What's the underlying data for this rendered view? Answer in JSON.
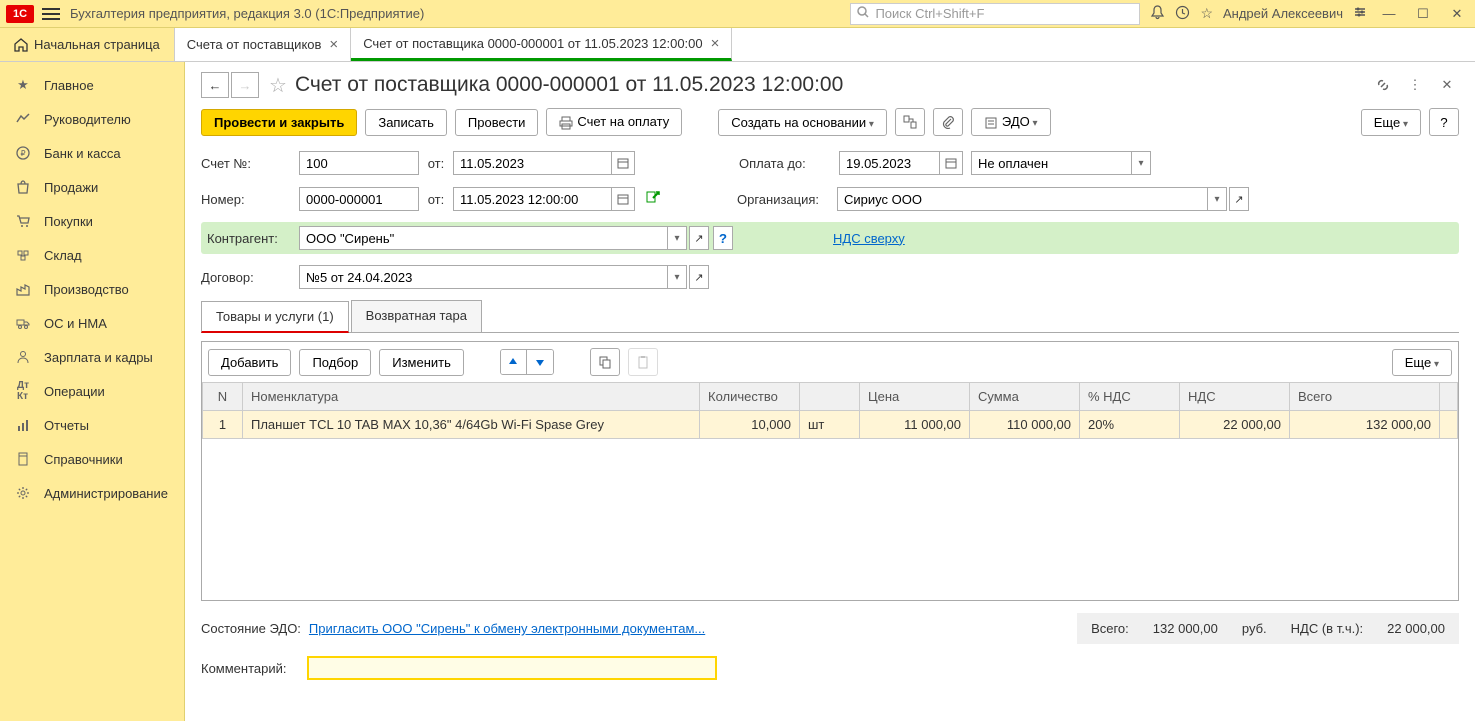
{
  "titlebar": {
    "app_title": "Бухгалтерия предприятия, редакция 3.0  (1С:Предприятие)",
    "search_placeholder": "Поиск Ctrl+Shift+F",
    "user": "Андрей Алексеевич"
  },
  "tabs": {
    "home": "Начальная страница",
    "items": [
      {
        "label": "Счета от поставщиков"
      },
      {
        "label": "Счет от поставщика 0000-000001 от 11.05.2023 12:00:00"
      }
    ]
  },
  "sidebar": {
    "items": [
      {
        "label": "Главное"
      },
      {
        "label": "Руководителю"
      },
      {
        "label": "Банк и касса"
      },
      {
        "label": "Продажи"
      },
      {
        "label": "Покупки"
      },
      {
        "label": "Склад"
      },
      {
        "label": "Производство"
      },
      {
        "label": "ОС и НМА"
      },
      {
        "label": "Зарплата и кадры"
      },
      {
        "label": "Операции"
      },
      {
        "label": "Отчеты"
      },
      {
        "label": "Справочники"
      },
      {
        "label": "Администрирование"
      }
    ]
  },
  "document": {
    "title": "Счет от поставщика 0000-000001 от 11.05.2023 12:00:00",
    "toolbar": {
      "post_close": "Провести и закрыть",
      "save": "Записать",
      "post": "Провести",
      "print_invoice": "Счет на оплату",
      "create_based": "Создать на основании",
      "edo": "ЭДО",
      "more": "Еще"
    },
    "fields": {
      "account_no_label": "Счет №:",
      "account_no": "100",
      "from_label": "от:",
      "account_date": "11.05.2023",
      "number_label": "Номер:",
      "number": "0000-000001",
      "number_date": "11.05.2023 12:00:00",
      "counterparty_label": "Контрагент:",
      "counterparty": "ООО \"Сирень\"",
      "contract_label": "Договор:",
      "contract": "№5 от 24.04.2023",
      "payment_until_label": "Оплата до:",
      "payment_until": "19.05.2023",
      "payment_status": "Не оплачен",
      "org_label": "Организация:",
      "org": "Сириус ООО",
      "vat_link": "НДС сверху"
    },
    "sub_tabs": {
      "goods": "Товары и услуги (1)",
      "tare": "Возвратная тара"
    },
    "table_toolbar": {
      "add": "Добавить",
      "pick": "Подбор",
      "edit": "Изменить",
      "more": "Еще"
    },
    "table": {
      "headers": {
        "n": "N",
        "nomenclature": "Номенклатура",
        "qty": "Количество",
        "unit": "",
        "price": "Цена",
        "sum": "Сумма",
        "vat_pct": "% НДС",
        "vat": "НДС",
        "total": "Всего"
      },
      "rows": [
        {
          "n": "1",
          "nomenclature": "Планшет TCL 10 TAB MAX 10,36\" 4/64Gb Wi-Fi Spase Grey",
          "qty": "10,000",
          "unit": "шт",
          "price": "11 000,00",
          "sum": "110 000,00",
          "vat_pct": "20%",
          "vat": "22 000,00",
          "total": "132 000,00"
        }
      ]
    },
    "edo_state_label": "Состояние ЭДО:",
    "edo_link": "Пригласить ООО \"Сирень\" к обмену электронными документам...",
    "totals": {
      "total_label": "Всего:",
      "total": "132 000,00",
      "currency": "руб.",
      "vat_label": "НДС (в т.ч.):",
      "vat": "22 000,00"
    },
    "comment_label": "Комментарий:"
  }
}
